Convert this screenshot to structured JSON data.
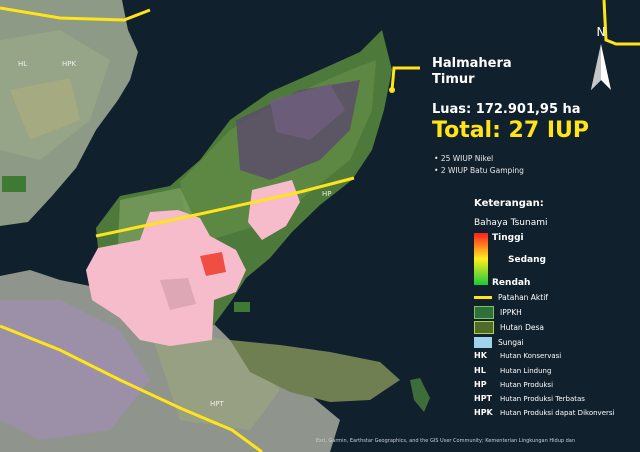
{
  "region": {
    "name_line1": "Halmahera",
    "name_line2": "Timur"
  },
  "stats": {
    "area": "Luas: 172.901,95 ha",
    "total": "Total: 27 IUP",
    "items": [
      "25 WIUP Nikel",
      "2 WIUP Batu Gamping"
    ]
  },
  "legend": {
    "title": "Keterangan:",
    "tsunami_title": "Bahaya Tsunami",
    "tsunami_levels": {
      "high": "Tinggi",
      "medium": "Sedang",
      "low": "Rendah"
    },
    "items": [
      {
        "label": "Patahan Aktif",
        "color": "#ffe41a"
      },
      {
        "label": "IPPKH",
        "color": "#2f6f38"
      },
      {
        "label": "Hutan Desa",
        "color": "#4f6b2a"
      },
      {
        "label": "Sungai",
        "color": "#9fd3ec"
      }
    ],
    "forest_codes": [
      {
        "code": "HK",
        "desc": "Hutan Konservasi"
      },
      {
        "code": "HL",
        "desc": "Hutan Lindung"
      },
      {
        "code": "HP",
        "desc": "Hutan Produksi"
      },
      {
        "code": "HPT",
        "desc": "Hutan Produksi Terbatas"
      },
      {
        "code": "HPK",
        "desc": "Hutan Produksi dapat Dikonversi"
      }
    ]
  },
  "map_labels": {
    "hl": "HL",
    "hpk": "HPK",
    "hp": "HP",
    "hpt": "HPT",
    "compass": "N"
  },
  "attribution": "Esri, Garmin, Earthstar Geographics, and the GIS User Community; Kementerian Lingkungan Hidup dan"
}
